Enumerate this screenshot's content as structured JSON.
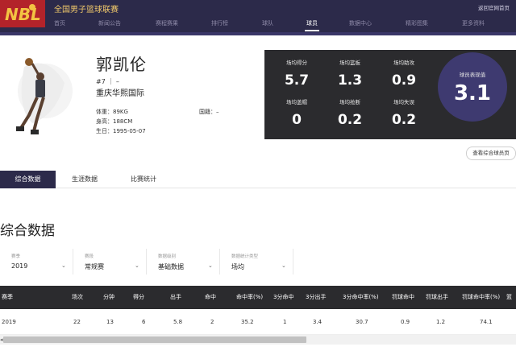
{
  "header": {
    "logo_text": "NBL",
    "site_title": "全国男子篮球联赛",
    "return_home": "返回官网首页",
    "nav": [
      {
        "label": "首页",
        "active": false
      },
      {
        "label": "新闻公告",
        "active": false
      },
      {
        "label": "赛程赛果",
        "active": false
      },
      {
        "label": "排行榜",
        "active": false
      },
      {
        "label": "球队",
        "active": false
      },
      {
        "label": "球员",
        "active": true
      },
      {
        "label": "数据中心",
        "active": false
      },
      {
        "label": "精彩图集",
        "active": false
      },
      {
        "label": "更多资料",
        "active": false
      }
    ]
  },
  "player": {
    "name": "郭凯伦",
    "number": "#7 ｜ –",
    "team": "重庆华熙国际",
    "weight": "体重：89KG",
    "height": "身高：188CM",
    "birthday": "生日：1995-05-07",
    "nationality": "国籍：–"
  },
  "stats": [
    {
      "label": "场均得分",
      "value": "5.7"
    },
    {
      "label": "场均篮板",
      "value": "1.3"
    },
    {
      "label": "场均助攻",
      "value": "0.9"
    },
    {
      "label": "场均盖帽",
      "value": "0"
    },
    {
      "label": "场均抢断",
      "value": "0.2"
    },
    {
      "label": "场均失误",
      "value": "0.2"
    }
  ],
  "performance": {
    "label": "球员表现值",
    "value": "3.1"
  },
  "view_all_button": "查看综合球员页",
  "tabs": [
    {
      "label": "综合数据",
      "active": true
    },
    {
      "label": "生涯数据",
      "active": false
    },
    {
      "label": "比赛统计",
      "active": false
    }
  ],
  "section_title": "综合数据",
  "filters": [
    {
      "label": "赛季",
      "value": "2019"
    },
    {
      "label": "赛段",
      "value": "常规赛"
    },
    {
      "label": "数据级别",
      "value": "基础数据"
    },
    {
      "label": "数据统计类型",
      "value": "场均"
    }
  ],
  "table": {
    "headers": [
      "赛季",
      "场次",
      "分钟",
      "得分",
      "出手",
      "命中",
      "命中率(%)",
      "3分命中",
      "3分出手",
      "3分命中率(%)",
      "罚球命中",
      "罚球出手",
      "罚球命中率(%)",
      "篮"
    ],
    "rows": [
      [
        "2019",
        "22",
        "13",
        "6",
        "5.8",
        "2",
        "35.2",
        "1",
        "3.4",
        "30.7",
        "0.9",
        "1.2",
        "74.1",
        ""
      ]
    ]
  },
  "colors": {
    "header_bg": "#2c2a4a",
    "panel_bg": "#2b2b2e",
    "circle_bg": "#3e3a70",
    "title_gold": "#f0c86b"
  }
}
